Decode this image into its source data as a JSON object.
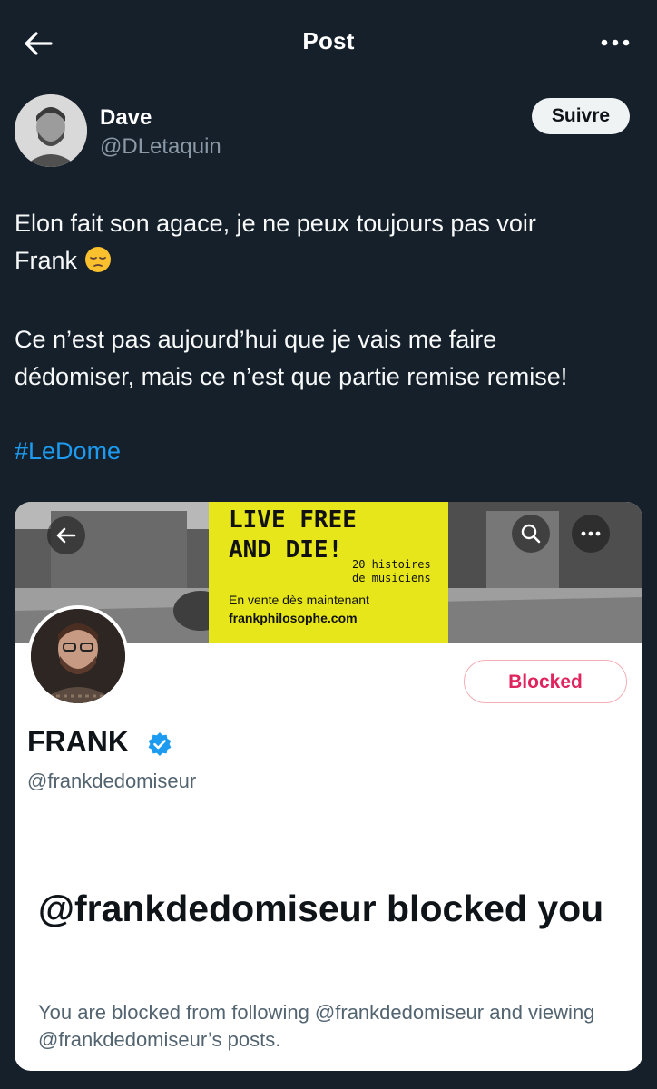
{
  "header": {
    "title": "Post",
    "back_icon": "arrow-left-icon",
    "more_icon": "more-horizontal-icon"
  },
  "author": {
    "name": "Dave",
    "handle": "@DLetaquin",
    "follow_label": "Suivre"
  },
  "tweet": {
    "line1": "Elon fait son agace, je ne peux toujours pas voir",
    "line2": "Frank",
    "emoji": "pensive-face-emoji",
    "line3": "Ce n’est pas aujourd’hui que je vais me faire",
    "line4": "dédomiser, mais ce n’est que partie remise remise!",
    "hashtag": "#LeDome"
  },
  "embed": {
    "banner": {
      "poster_title": "LIVE FREE\nAND DIE!",
      "poster_subtitle": "20 histoires\nde musiciens",
      "poster_sale": "En vente dès maintenant",
      "poster_site": "frankphilosophe.com",
      "poster_color": "#e6e61a"
    },
    "profile": {
      "name": "FRANK",
      "handle": "@frankdedomiseur",
      "blocked_label": "Blocked",
      "verified": true
    },
    "blocked_heading": "@frankdedomiseur blocked you",
    "blocked_description": "You are blocked from following @frankdedomiseur and viewing @frankdedomiseur’s posts."
  },
  "colors": {
    "background": "#15202b",
    "accent": "#1d9bf0",
    "blocked": "#e0245e",
    "secondary_text": "#8b98a5"
  }
}
